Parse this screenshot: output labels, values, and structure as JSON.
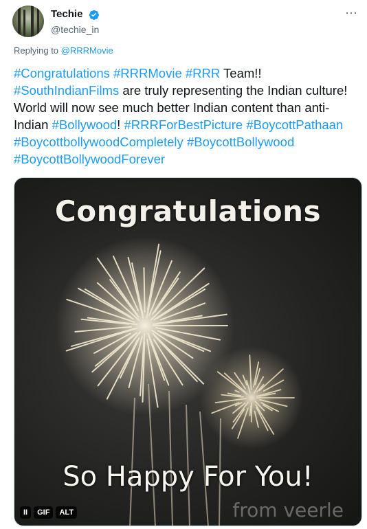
{
  "author": {
    "display_name": "Techie",
    "handle": "@techie_in",
    "verified_icon": "verified-badge-icon",
    "avatar_icon": "forest-avatar"
  },
  "more_icon": "more-options-icon",
  "reply": {
    "prefix": "Replying to",
    "to": "@RRRMovie"
  },
  "tweet": {
    "t1": "#Congratulations",
    "t2": " ",
    "t3": "#RRRMovie",
    "t4": " ",
    "t5": "#RRR",
    "t6": " Team!! ",
    "t7": "#SouthIndianFilms",
    "t8": " are truly representing the Indian culture! World will now see much better Indian content than anti-Indian ",
    "t9": "#Bollywood",
    "t10": "! ",
    "t11": "#RRRForBestPicture",
    "t12": " ",
    "t13": "#BoycottPathaan",
    "t14": " ",
    "t15": "#BoycottbollywoodCompletely",
    "t16": " ",
    "t17": "#BoycottBollywood",
    "t18": " ",
    "t19": "#BoycottBollywoodForever"
  },
  "media": {
    "title": "Congratulations",
    "caption": "So Happy For You!",
    "watermark": "from veerle",
    "pause_label": "II",
    "gif_label": "GIF",
    "alt_label": "ALT"
  },
  "colors": {
    "accent": "#1d9bf0",
    "text": "#0f1419",
    "muted": "#536471"
  }
}
